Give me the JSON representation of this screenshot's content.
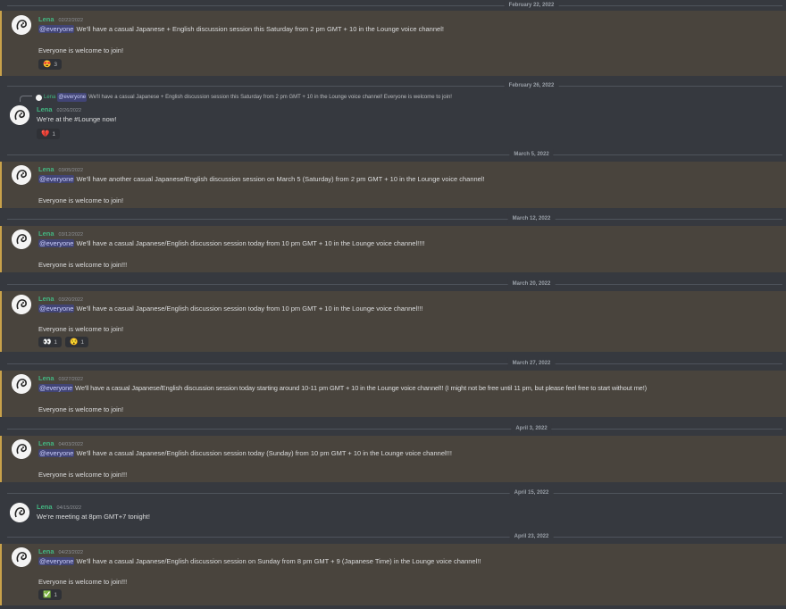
{
  "colors": {
    "background": "#36393f",
    "highlight": "#49443d",
    "highlight_border": "#c9a24a",
    "username": "#43b581",
    "mention_bg": "#414475"
  },
  "dividers": [
    "February 22, 2022",
    "February 26, 2022",
    "March 5, 2022",
    "March 12, 2022",
    "March 20, 2022",
    "March 27, 2022",
    "April 3, 2022",
    "April 15, 2022",
    "April 23, 2022"
  ],
  "messages": [
    {
      "author": "Lena",
      "date": "02/22/2022",
      "mention": "@everyone",
      "line1": " We'll have a casual Japanese + English discussion session this Saturday from 2 pm GMT + 10 in the Lounge voice channel!",
      "line2": "Everyone is welcome to join!",
      "reactions": [
        {
          "emoji": "😍",
          "count": "3"
        }
      ]
    },
    {
      "author": "Lena",
      "date": "02/26/2022",
      "reply": {
        "author": "Lena",
        "mention": "@everyone",
        "text": " We'll have a casual Japanese + English discussion session this Saturday from 2 pm GMT + 10 in the Lounge voice channel!  Everyone is welcome to join!"
      },
      "line1": "We're at the #Lounge now!",
      "reactions": [
        {
          "emoji": "💔",
          "count": "1"
        }
      ]
    },
    {
      "author": "Lena",
      "date": "03/05/2022",
      "mention": "@everyone",
      "line1": " We'll have another casual Japanese/English discussion session on March 5 (Saturday) from 2 pm GMT + 10 in the Lounge voice channel!",
      "line2": "Everyone is welcome to join!"
    },
    {
      "author": "Lena",
      "date": "03/12/2022",
      "mention": "@everyone",
      "line1": " We'll have a casual Japanese/English discussion session today from 10 pm GMT + 10 in the Lounge voice channel!!!!",
      "line2": "Everyone is welcome to join!!!"
    },
    {
      "author": "Lena",
      "date": "03/20/2022",
      "mention": "@everyone",
      "line1": " We'll have a casual Japanese/English discussion session today from 10 pm GMT + 10 in the Lounge voice channel!!!",
      "line2": "Everyone is welcome to join!",
      "reactions": [
        {
          "emoji": "👀",
          "count": "1"
        },
        {
          "emoji": "😯",
          "count": "1"
        }
      ]
    },
    {
      "author": "Lena",
      "date": "03/27/2022",
      "mention": "@everyone",
      "line1": " We'll have a casual Japanese/English discussion session today starting around 10-11 pm GMT + 10 in the Lounge voice channel!! (I might not be free until 11 pm, but please feel free to start without me!)",
      "line2": "Everyone is welcome to join!"
    },
    {
      "author": "Lena",
      "date": "04/03/2022",
      "mention": "@everyone",
      "line1": " We'll have a casual Japanese/English discussion session today (Sunday) from 10 pm GMT + 10 in the Lounge voice channel!!!",
      "line2": "Everyone is welcome to join!!!"
    },
    {
      "author": "Lena",
      "date": "04/15/2022",
      "line1": "We're meeting at 8pm GMT+7 tonight!"
    },
    {
      "author": "Lena",
      "date": "04/23/2022",
      "mention": "@everyone",
      "line1": " We'll have a casual Japanese/English discussion session on Sunday from 8 pm GMT + 9 (Japanese Time) in the Lounge voice channel!!",
      "line2": "Everyone is welcome to join!!!",
      "reactions": [
        {
          "emoji": "✅",
          "count": "1"
        }
      ]
    }
  ]
}
